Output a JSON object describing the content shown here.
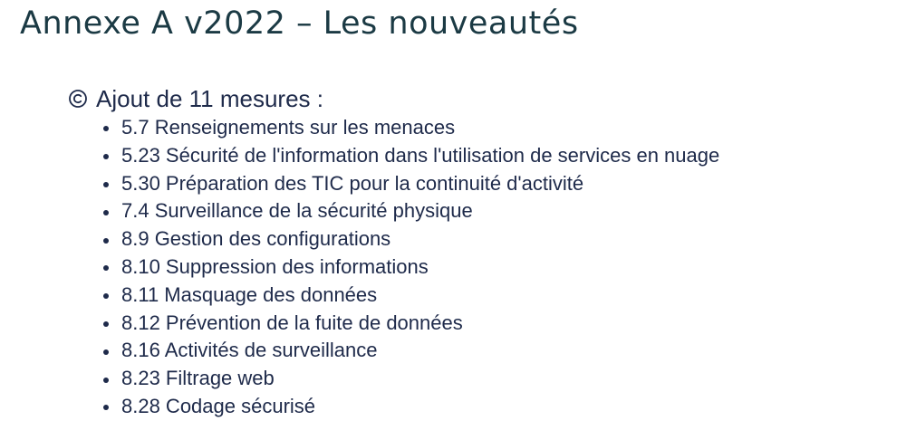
{
  "slide": {
    "title": "Annexe A v2022 – Les nouveautés",
    "heading": {
      "icon": "copyright-circle-icon",
      "text": "Ajout de 11 mesures :"
    },
    "items": [
      "5.7 Renseignements sur les menaces",
      "5.23 Sécurité de l'information dans l'utilisation de services en nuage",
      "5.30 Préparation des TIC pour la continuité d'activité",
      "7.4 Surveillance de la sécurité physique",
      "8.9 Gestion des configurations",
      "8.10 Suppression des informations",
      "8.11 Masquage des données",
      "8.12 Prévention de la fuite de données",
      "8.16 Activités de surveillance",
      "8.23 Filtrage web",
      "8.28 Codage sécurisé"
    ],
    "colors": {
      "title": "#1b3a44",
      "text": "#1e2a4a",
      "background": "#ffffff"
    }
  }
}
